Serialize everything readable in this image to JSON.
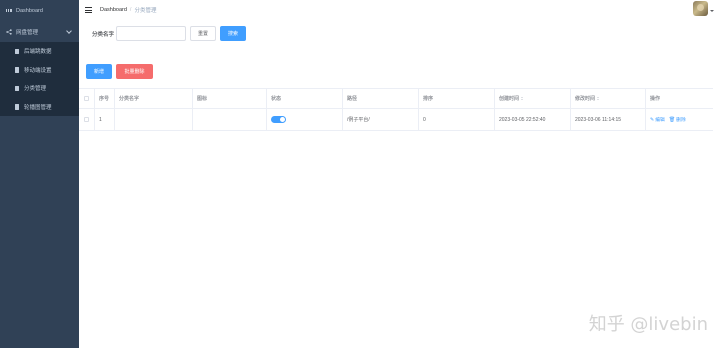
{
  "sidebar": {
    "dashboard": "Dashboard",
    "group": "网盘管理",
    "items": [
      {
        "label": "后端跳数据"
      },
      {
        "label": "移动端设置"
      },
      {
        "label": "分类管理"
      },
      {
        "label": "轮播图管理"
      }
    ]
  },
  "header": {
    "breadcrumb_home": "Dashboard",
    "breadcrumb_sep": "/",
    "breadcrumb_current": "分类管理"
  },
  "search": {
    "label": "分类名字",
    "value": "",
    "placeholder": "",
    "reset_label": "重置",
    "search_label": "搜索"
  },
  "actions": {
    "add_label": "新增",
    "batch_delete_label": "批量删除"
  },
  "table": {
    "columns": [
      "序号",
      "分类名字",
      "图标",
      "状态",
      "路径",
      "排序",
      "创建时间",
      "修改时间",
      "操作"
    ],
    "rows": [
      {
        "index": "1",
        "name": "",
        "icon": "",
        "status_on": true,
        "path": "/例子平台/",
        "sort": "0",
        "created": "2023-03-05 22:52:40",
        "updated": "2023-03-06 11:14:15",
        "edit_label": "编辑",
        "delete_label": "删除"
      }
    ]
  },
  "colors": {
    "sidebar_bg": "#304156",
    "primary": "#409eff",
    "danger": "#f56c6c"
  },
  "watermark": "知乎 @livebin"
}
